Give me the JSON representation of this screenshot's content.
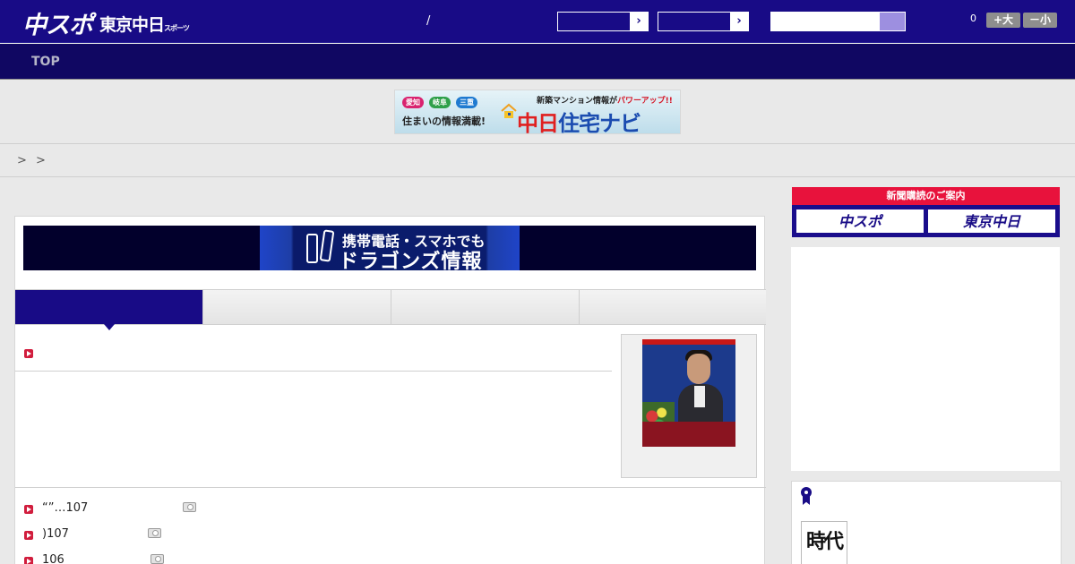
{
  "header": {
    "logo_main": "中スポ",
    "logo_sub": "東京中日",
    "logo_sub_small": "スポーツ",
    "slash": "/",
    "select_arrow": "›",
    "font_count": "0",
    "font_up_label": "+大",
    "font_down_label": "－小"
  },
  "nav": {
    "top_label": "TOP"
  },
  "ad_banner": {
    "pills": [
      "愛知",
      "岐阜",
      "三重"
    ],
    "tagline": "住まいの情報満載!",
    "promo_prefix": "新築マンション情報が",
    "promo_highlight": "パワーアップ!!",
    "title_red": "中日",
    "title_blue": "住宅ナビ"
  },
  "breadcrumb": {
    "text": "> >"
  },
  "phone_banner": {
    "line1": "携帯電話・スマホでも",
    "line2": "ドラゴンズ情報"
  },
  "news": {
    "items": [
      {
        "text": "“”…107"
      },
      {
        "text": ")107"
      },
      {
        "text": "106"
      }
    ]
  },
  "sidebar": {
    "subscribe_title": "新聞購読のご案内",
    "subscribe_buttons": [
      "中スポ",
      "東京中日"
    ],
    "thumb_text": "時代"
  },
  "colors": {
    "brand_navy": "#180b86",
    "accent_red": "#e8123c",
    "bullet_red": "#d11d3d"
  }
}
